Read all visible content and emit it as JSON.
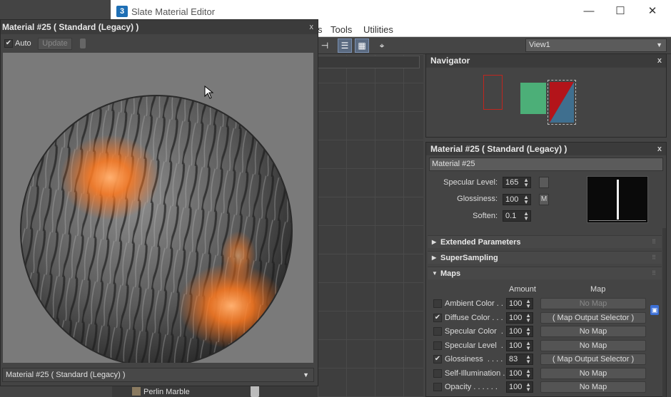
{
  "slate": {
    "title": "Slate Material Editor",
    "app_icon_letter": "3",
    "menu": [
      "Tools",
      "Utilities"
    ],
    "window_controls": {
      "minimize": "—",
      "maximize": "☐",
      "close": "✕"
    },
    "view_select": "View1"
  },
  "navigator": {
    "title": "Navigator",
    "close": "x"
  },
  "material_panel": {
    "title": "Material #25  ( Standard (Legacy) )",
    "close": "x",
    "name_value": "Material #25",
    "specular_level_label": "Specular Level:",
    "specular_level_value": "165",
    "glossiness_label": "Glossiness:",
    "glossiness_value": "100",
    "glossiness_map_btn": "M",
    "soften_label": "Soften:",
    "soften_value": "0.1",
    "rollouts": [
      {
        "label": "Extended Parameters",
        "tri": "▶"
      },
      {
        "label": "SuperSampling",
        "tri": "▶"
      },
      {
        "label": "Maps",
        "tri": "▼"
      }
    ],
    "maps_header": {
      "amount": "Amount",
      "map": "Map"
    },
    "maps": [
      {
        "label": "Ambient Color . .",
        "checked": false,
        "check": "",
        "amount": "100",
        "map": "No Map",
        "empty": true
      },
      {
        "label": "Diffuse Color . . .",
        "checked": true,
        "check": "✔",
        "amount": "100",
        "map": "( Map Output Selector )",
        "empty": false
      },
      {
        "label": "Specular Color  .",
        "checked": false,
        "check": "",
        "amount": "100",
        "map": "No Map",
        "empty": false
      },
      {
        "label": "Specular Level  .",
        "checked": false,
        "check": "",
        "amount": "100",
        "map": "No Map",
        "empty": false
      },
      {
        "label": "Glossiness  . . . .",
        "checked": true,
        "check": "✔",
        "amount": "83",
        "map": "( Map Output Selector )",
        "empty": false
      },
      {
        "label": "Self-Illumination .",
        "checked": false,
        "check": "",
        "amount": "100",
        "map": "No Map",
        "empty": false
      },
      {
        "label": "Opacity . . . . . .",
        "checked": false,
        "check": "",
        "amount": "100",
        "map": "No Map",
        "empty": false
      }
    ]
  },
  "preview": {
    "title": "Material #25  ( Standard (Legacy) )",
    "close": "x",
    "auto_label": "Auto",
    "auto_check": "✔",
    "update_label": "Update",
    "select_value": "Material #25  ( Standard (Legacy) )"
  },
  "browser": {
    "perlin_label": "Perlin Marble"
  },
  "icons": [
    "app-icon",
    "close-icon",
    "maximize-icon",
    "minimize-icon",
    "chevron-down-icon",
    "lock-icon",
    "pin-icon",
    "cursor-icon",
    "node-icon",
    "perlin-marble-icon",
    "toolbar-layout-icon",
    "toolbar-hide-icon",
    "toolbar-grid-icon",
    "toolbar-select-icon"
  ],
  "colors": {
    "accent_blue": "#3b6fd6",
    "nav_red": "#c0261f",
    "nav_green": "#4caf78",
    "swatch_blue": "#3f6f8f",
    "glow_orange": "#ff8a2a"
  }
}
